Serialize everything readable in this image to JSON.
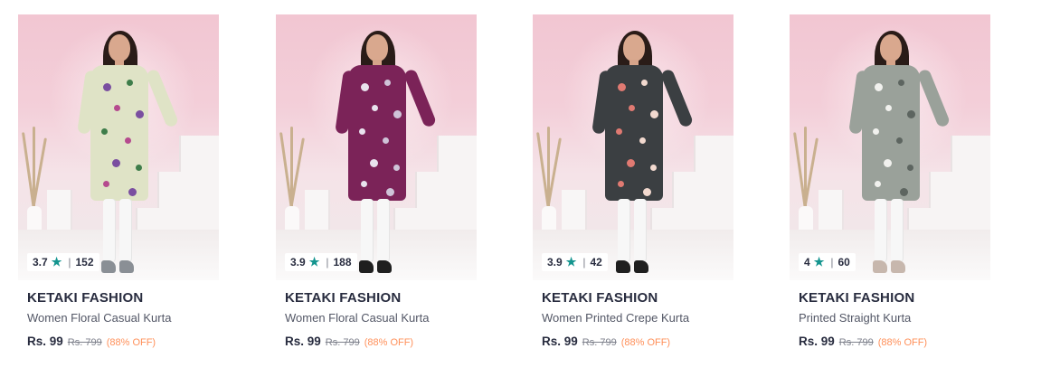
{
  "products": [
    {
      "brand": "KETAKI FASHION",
      "name": "Women Floral Casual Kurta",
      "rating": "3.7",
      "rating_count": "152",
      "price": "Rs. 99",
      "mrp": "Rs. 799",
      "discount": "(88% OFF)",
      "kurta_color": "#dfe3c6",
      "print_colors": [
        "#7a4ea0",
        "#3e7d4a",
        "#b54a8e"
      ],
      "shoe_color": "#8a8f95"
    },
    {
      "brand": "KETAKI FASHION",
      "name": "Women Floral Casual Kurta",
      "rating": "3.9",
      "rating_count": "188",
      "price": "Rs. 99",
      "mrp": "Rs. 799",
      "discount": "(88% OFF)",
      "kurta_color": "#7b2358",
      "print_colors": [
        "#e9e3ee",
        "#cfc3d8"
      ],
      "shoe_color": "#1f1f1f"
    },
    {
      "brand": "KETAKI FASHION",
      "name": "Women Printed Crepe Kurta",
      "rating": "3.9",
      "rating_count": "42",
      "price": "Rs. 99",
      "mrp": "Rs. 799",
      "discount": "(88% OFF)",
      "kurta_color": "#3b3f42",
      "print_colors": [
        "#e07a72",
        "#f2d9cf"
      ],
      "shoe_color": "#1f1f1f"
    },
    {
      "brand": "KETAKI FASHION",
      "name": "Printed Straight Kurta",
      "rating": "4",
      "rating_count": "60",
      "price": "Rs. 99",
      "mrp": "Rs. 799",
      "discount": "(88% OFF)",
      "kurta_color": "#9aa19a",
      "print_colors": [
        "#f1f1ee",
        "#5d6560"
      ],
      "shoe_color": "#c7b7ad"
    }
  ],
  "colors": {
    "rating_star": "#14958f",
    "brand_text": "#282c3f",
    "name_text": "#535766",
    "discount_text": "#ff905a"
  }
}
